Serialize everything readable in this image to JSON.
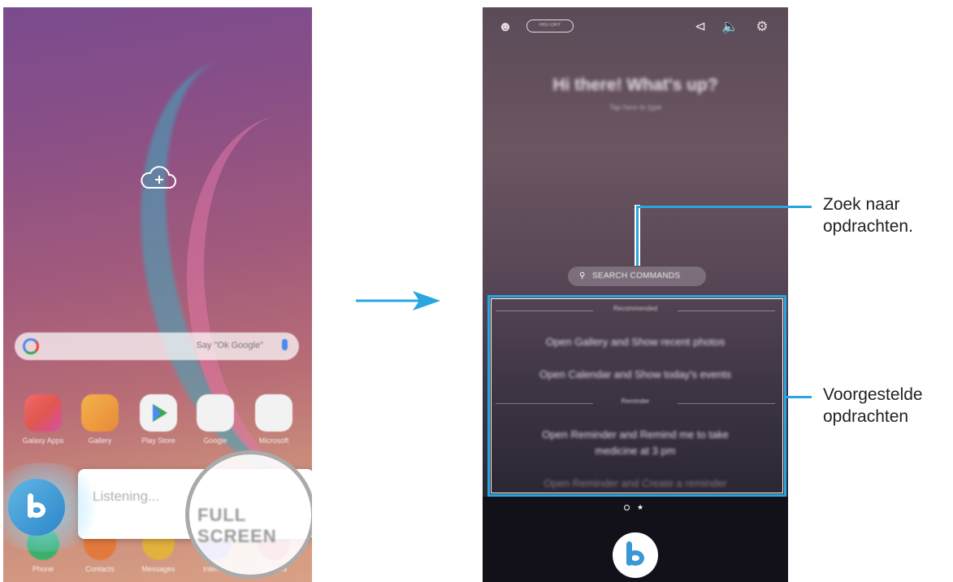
{
  "left_phone": {
    "google_bar_hint": "Say \"Ok Google\"",
    "apps": [
      {
        "label": "Galaxy Apps",
        "icon": "galaxy-apps-icon",
        "color": "#e0574f"
      },
      {
        "label": "Gallery",
        "icon": "gallery-icon",
        "color": "#e89a3a"
      },
      {
        "label": "Play Store",
        "icon": "play-store-icon",
        "color": "#f2f2f2"
      },
      {
        "label": "Google",
        "icon": "google-folder-icon",
        "color": "#f2f2f2"
      },
      {
        "label": "Microsoft",
        "icon": "microsoft-folder-icon",
        "color": "#f2f2f2"
      }
    ],
    "dock": [
      {
        "label": "Phone",
        "icon": "phone-icon"
      },
      {
        "label": "Contacts",
        "icon": "contacts-icon"
      },
      {
        "label": "Messages",
        "icon": "messages-icon"
      },
      {
        "label": "Internet",
        "icon": "internet-icon"
      },
      {
        "label": "Camera",
        "icon": "camera-icon"
      }
    ],
    "listening_text": "Listening...",
    "full_screen_label": "FULL SCREEN"
  },
  "right_phone": {
    "history_label": "HISTORY",
    "greeting": "Hi there! What's up?",
    "greeting_sub": "Tap here to type",
    "search_commands_label": "SEARCH COMMANDS",
    "section_recommended": "Recommended",
    "recommended": [
      "Open Gallery and Show recent photos",
      "Open Calendar and Show today's events"
    ],
    "section_reminder": "Reminder",
    "reminder": [
      "Open Reminder and Remind me to take",
      "medicine at 3 pm",
      "Open Reminder and Create a reminder"
    ]
  },
  "annotations": {
    "search_note_line1": "Zoek naar",
    "search_note_line2": "opdrachten.",
    "suggested_note_line1": "Voorgestelde",
    "suggested_note_line2": "opdrachten"
  },
  "colors": {
    "callout": "#29a6e0",
    "bixby": "#3a98d8"
  }
}
